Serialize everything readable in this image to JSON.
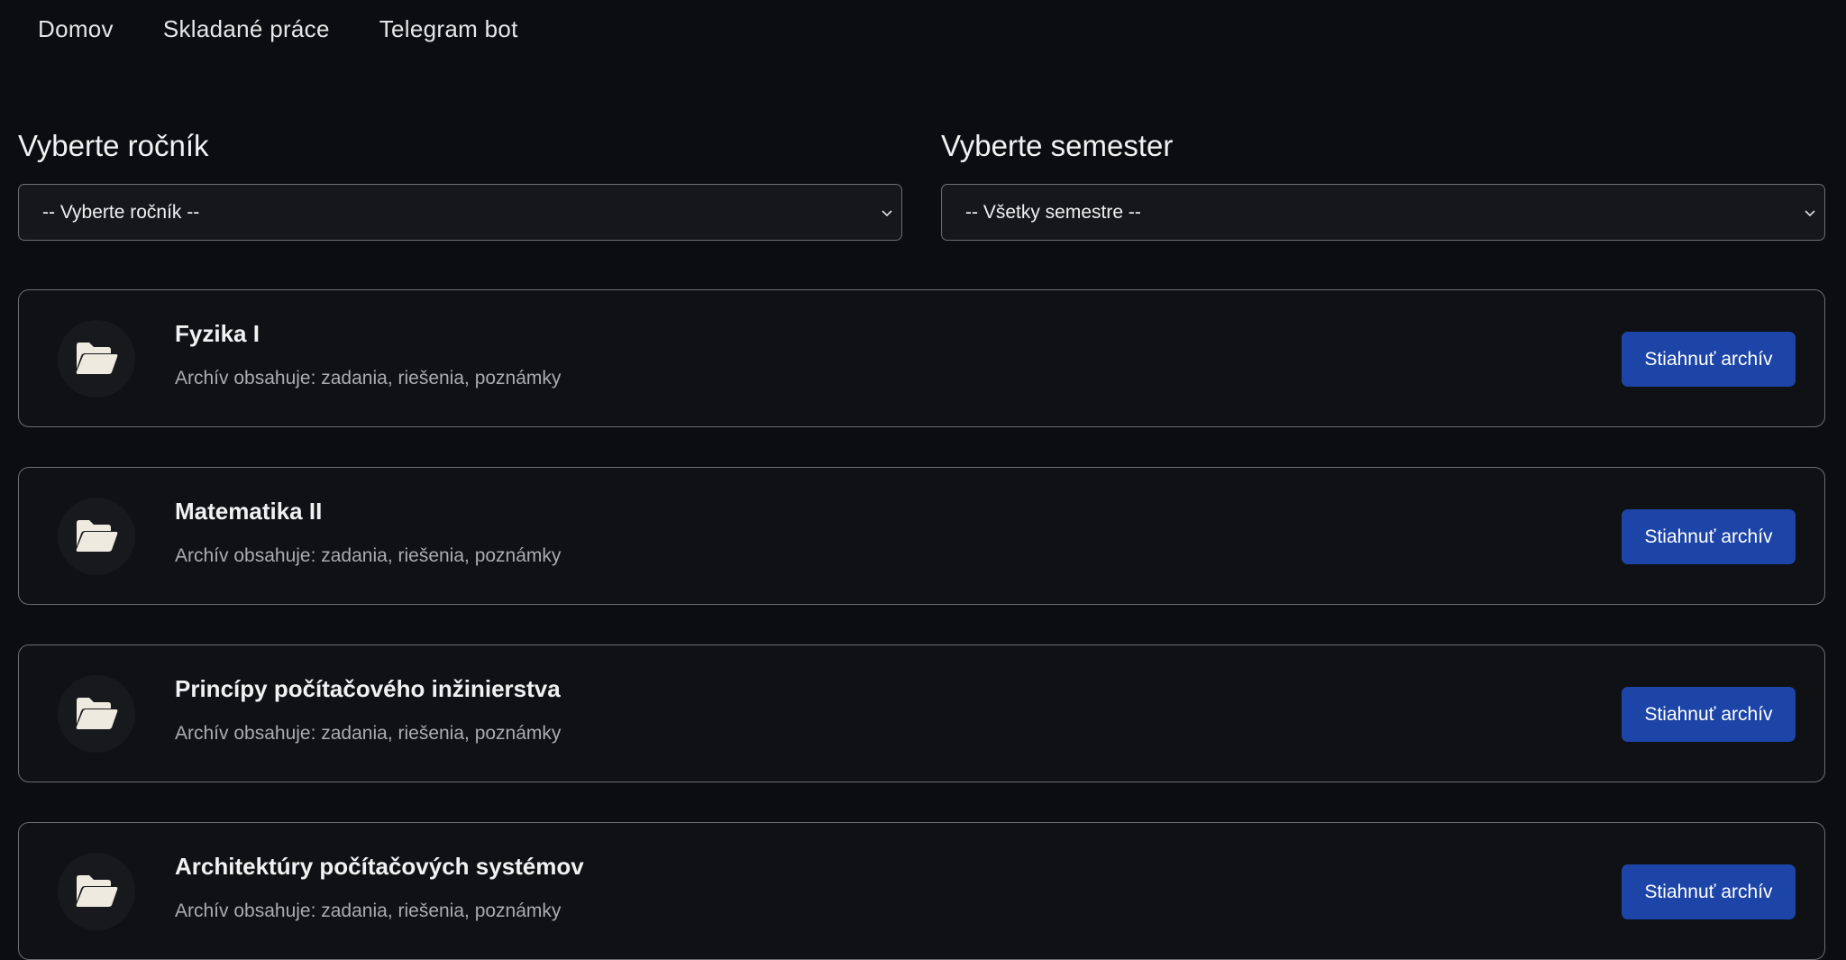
{
  "nav": {
    "items": [
      {
        "label": "Domov"
      },
      {
        "label": "Skladané práce"
      },
      {
        "label": "Telegram bot"
      }
    ]
  },
  "filters": {
    "year": {
      "label": "Vyberte ročník",
      "selected": "-- Vyberte ročník --"
    },
    "semester": {
      "label": "Vyberte semester",
      "selected": "-- Všetky semestre --"
    }
  },
  "cards": [
    {
      "title": "Fyzika I",
      "description": "Archív obsahuje: zadania, riešenia, poznámky",
      "button_label": "Stiahnuť archív",
      "icon": "folder-open-icon"
    },
    {
      "title": "Matematika II",
      "description": "Archív obsahuje: zadania, riešenia, poznámky",
      "button_label": "Stiahnuť archív",
      "icon": "folder-open-icon"
    },
    {
      "title": "Princípy počítačového inžinierstva",
      "description": "Archív obsahuje: zadania, riešenia, poznámky",
      "button_label": "Stiahnuť archív",
      "icon": "folder-open-icon"
    },
    {
      "title": "Architektúry počítačových systémov",
      "description": "Archív obsahuje: zadania, riešenia, poznámky",
      "button_label": "Stiahnuť archív",
      "icon": "folder-open-icon"
    }
  ],
  "colors": {
    "background": "#0b0d10",
    "card_background": "#0f1114",
    "border": "#6b6e73",
    "accent_button": "#1d45a8",
    "icon_circle": "#17191c",
    "icon_fill": "#eeeae0"
  }
}
